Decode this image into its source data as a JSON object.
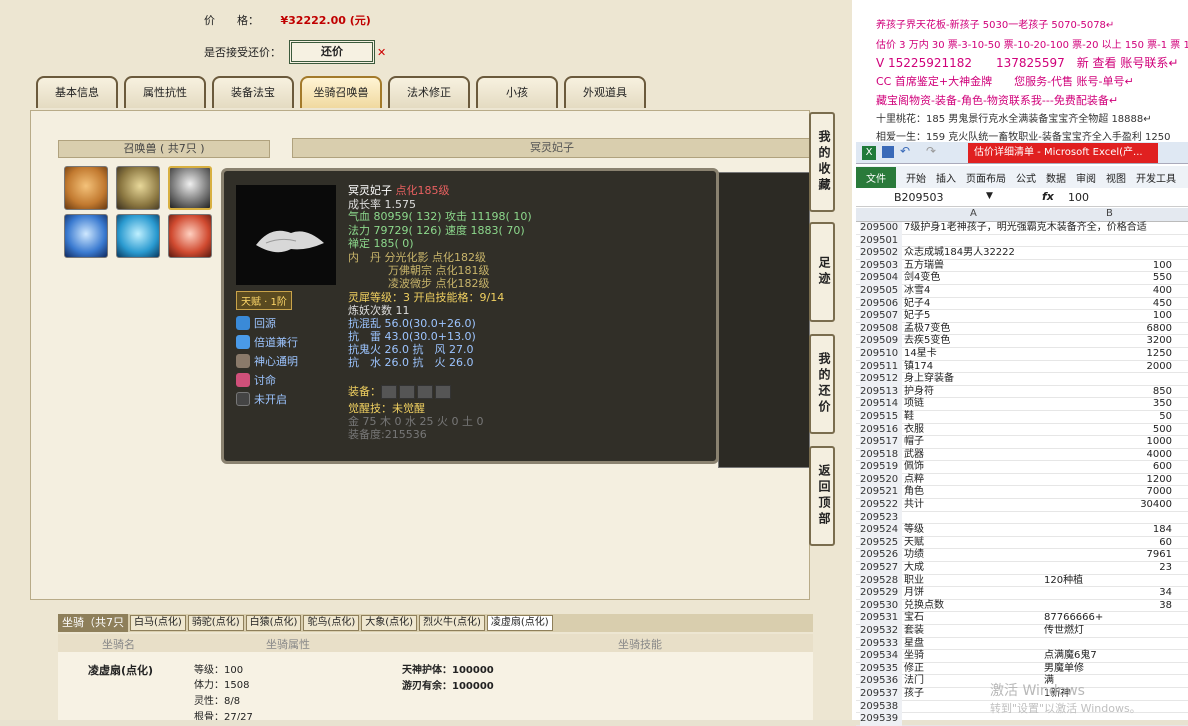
{
  "trade": {
    "price_label": "价　　格：",
    "price_value": "¥32222.00 (元)",
    "bargain_label": "是否接受还价：",
    "bargain_button": "还价",
    "close_mark": "✕"
  },
  "tabs": [
    "基本信息",
    "属性抗性",
    "装备法宝",
    "坐骑召唤兽",
    "法术修正",
    "小孩",
    "外观道具"
  ],
  "summon": {
    "header": "召唤兽 ( 共7只 )",
    "detail_header": "冥灵妃子"
  },
  "side_buttons": [
    "我的收藏",
    "足迹",
    "我的还价",
    "返回顶部"
  ],
  "popup": {
    "name": "冥灵妃子",
    "name_suffix": "点化185级",
    "growth": "成长率 1.575",
    "line_qixue": "气血 80959( 132) 攻击 11198( 10)",
    "line_fali": "法力 79729( 126) 速度 1883( 70)",
    "line_dingding": "禅定 185( 0)",
    "neidan": "内　丹 分光化影 点化182级",
    "neidan2": "万佛朝宗 点化181级",
    "neidan3": "凌波微步 点化182级",
    "lingxi": "灵犀等级：3 开启技能格：9/14",
    "lianyao": "炼妖次数 11",
    "kang1": "抗混乱 56.0(30.0+26.0)",
    "kang2": "抗　雷 43.0(30.0+13.0)",
    "kang3": "抗鬼火 26.0 抗　风 27.0",
    "kang4": "抗　水 26.0 抗　火 26.0",
    "equip": "装备：",
    "juexing": "觉醒技：未觉醒",
    "wuxing": "金 75 木 0 水 25 火 0 土 0",
    "zhuangbei": "装备度:215536",
    "talent": "天赋 · 1阶",
    "skills": [
      "回源",
      "倍道兼行",
      "神心通明",
      "讨命",
      "未开启"
    ]
  },
  "mount": {
    "header_label": "坐骑（共7只",
    "tabs": [
      "白马(点化)",
      "骑驼(点化)",
      "白猿(点化)",
      "鸵鸟(点化)",
      "大象(点化)",
      "烈火牛(点化)",
      "凌虚扇(点化)"
    ],
    "col_name": "坐骑名",
    "col_attr": "坐骑属性",
    "col_skill": "坐骑技能",
    "name": "凌虚扇(点化)",
    "attrs": [
      "等级：100",
      "体力：1508",
      "灵性：8/8",
      "根骨：27/27"
    ],
    "skills": [
      "天神护体：100000",
      "游刃有余：100000"
    ]
  },
  "ads": [
    {
      "text": "养孩子界天花板-新孩子 5030一老孩子 5070-5078↵",
      "color": "#d0007a"
    },
    {
      "text": "估价 3 万内 30 票-3-10-50 票-10-20-100 票-20 以上 150 票-1 票 1",
      "color": "#d0007a"
    },
    {
      "text": "V 15225921182　　137825597　新 查看 账号联系↵",
      "color": "#d0007a"
    },
    {
      "text": "CC 首席鉴定+大神金牌　　您服务-代售 账号-单号↵",
      "color": "#d0007a"
    },
    {
      "text": "藏宝阁物资-装备-角色-物资联系我---免费配装备↵",
      "color": "#d0007a"
    },
    {
      "text": "十里桃花：185 男鬼景行克水全满装备宝宝齐全物超 18888↵",
      "color": "#333"
    },
    {
      "text": "相爱一生：159 克火队统一畜牧职业-装备宝宝齐全入手盈利 1250",
      "color": "#333"
    }
  ],
  "excel": {
    "title": "估价详细清单 - Microsoft Excel(产...",
    "ribbon": [
      "文件",
      "开始",
      "插入",
      "页面布局",
      "公式",
      "数据",
      "审阅",
      "视图",
      "开发工具"
    ],
    "cell_ref": "B209503",
    "fx": "fx",
    "formula": "100",
    "col_a": "A",
    "col_b": "B",
    "rows": [
      [
        "209500",
        "7级护身1老神孩子，明光强霸克木装备齐全，价格合适",
        ""
      ],
      [
        "209501",
        "",
        ""
      ],
      [
        "209502",
        "众志成城184男人32222",
        ""
      ],
      [
        "209503",
        "五方瑞兽",
        "100"
      ],
      [
        "209504",
        "剑4变色",
        "550"
      ],
      [
        "209505",
        "冰雪4",
        "400"
      ],
      [
        "209506",
        "妃子4",
        "450"
      ],
      [
        "209507",
        "妃子5",
        "100"
      ],
      [
        "209508",
        "孟极7变色",
        "6800"
      ],
      [
        "209509",
        "去疾5变色",
        "3200"
      ],
      [
        "209510",
        "14星卡",
        "1250"
      ],
      [
        "209511",
        "镇174",
        "2000"
      ],
      [
        "209512",
        "身上穿装备",
        ""
      ],
      [
        "209513",
        "护身符",
        "850"
      ],
      [
        "209514",
        "项链",
        "350"
      ],
      [
        "209515",
        "鞋",
        "50"
      ],
      [
        "209516",
        "衣服",
        "500"
      ],
      [
        "209517",
        "帽子",
        "1000"
      ],
      [
        "209518",
        "武器",
        "4000"
      ],
      [
        "209519",
        "佩饰",
        "600"
      ],
      [
        "209520",
        "点粹",
        "1200"
      ],
      [
        "209521",
        "角色",
        "7000"
      ],
      [
        "209522",
        "共计",
        "30400"
      ],
      [
        "209523",
        "",
        ""
      ],
      [
        "209524",
        "等级",
        "184"
      ],
      [
        "209525",
        "天赋",
        "60"
      ],
      [
        "209526",
        "功绩",
        "7961"
      ],
      [
        "209527",
        "大成",
        "23"
      ],
      [
        "209528",
        "职业",
        "120种植"
      ],
      [
        "209529",
        "月饼",
        "34"
      ],
      [
        "209530",
        "兑换点数",
        "38"
      ],
      [
        "209531",
        "宝石",
        "87766666+"
      ],
      [
        "209532",
        "套装",
        "传世燃灯"
      ],
      [
        "209533",
        "星盘",
        ""
      ],
      [
        "209534",
        "坐骑",
        "点满魔6鬼7"
      ],
      [
        "209535",
        "修正",
        "男魔单修"
      ],
      [
        "209536",
        "法门",
        "满"
      ],
      [
        "209537",
        "孩子",
        "1新神"
      ],
      [
        "209538",
        "",
        ""
      ],
      [
        "209539",
        "",
        ""
      ]
    ],
    "watermark": "激活 Windows",
    "watermark2": "转到\"设置\"以激活 Windows。"
  }
}
